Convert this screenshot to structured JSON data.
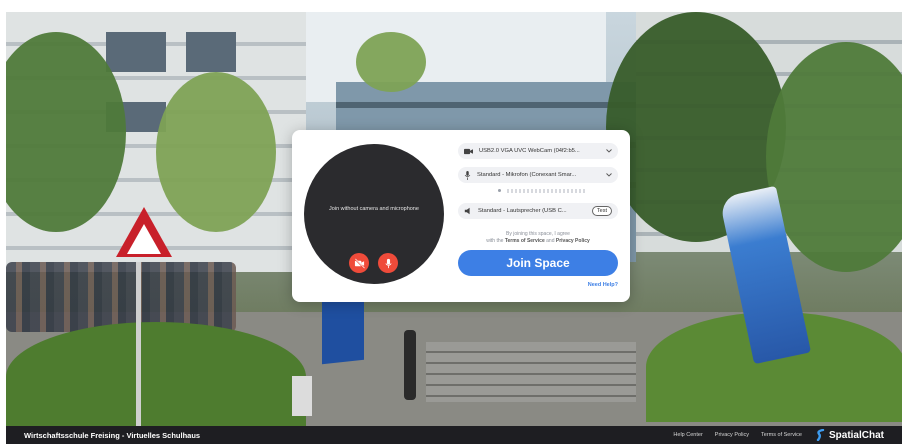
{
  "dialog": {
    "preview_text": "Join without camera and microphone",
    "camera_select": "USB2.0 VGA UVC WebCam (04f2:b5...",
    "mic_select": "Standard - Mikrofon (Conexant Smar...",
    "speaker_select": "Standard - Lautsprecher (USB C...",
    "test_label": "Test",
    "terms_prefix": "By joining this space, I agree",
    "terms_middle": "with the",
    "terms_link1": "Terms of Service",
    "terms_and": "and",
    "terms_link2": "Privacy Policy",
    "join_label": "Join Space",
    "help_label": "Need Help?"
  },
  "footer": {
    "title": "Wirtschaftsschule Freising - Virtuelles Schulhaus",
    "links": [
      "Help Center",
      "Privacy Policy",
      "Terms of Service"
    ],
    "brand": "SpatialChat"
  },
  "colors": {
    "accent": "#3d7fe5",
    "danger": "#ef4b3a",
    "footer_bg": "#1e1e22"
  },
  "icons": [
    "video-camera-icon",
    "microphone-icon",
    "speaker-icon",
    "chevron-down-icon",
    "camera-off-icon",
    "mic-off-icon",
    "spatialchat-logo-icon"
  ]
}
